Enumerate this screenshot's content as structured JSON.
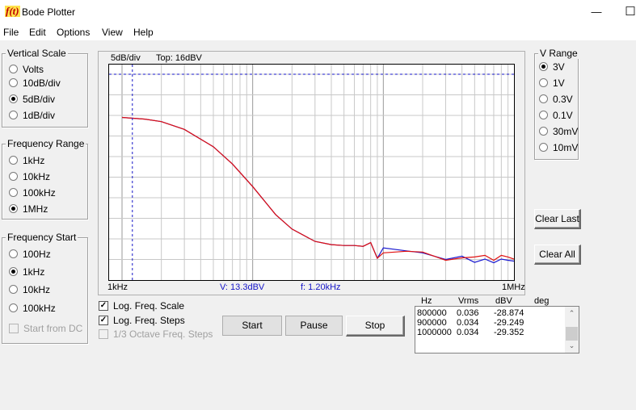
{
  "window": {
    "title": "Bode Plotter",
    "icon_text": "f(t)",
    "minimize_glyph": "—",
    "maximize_glyph": "☐"
  },
  "menu": [
    "File",
    "Edit",
    "Options",
    "View",
    "Help"
  ],
  "vertical_scale": {
    "title": "Vertical Scale",
    "options": [
      "Volts",
      "10dB/div",
      "5dB/div",
      "1dB/div"
    ],
    "selected": 2
  },
  "frequency_range": {
    "title": "Frequency Range",
    "options": [
      "1kHz",
      "10kHz",
      "100kHz",
      "1MHz"
    ],
    "selected": 3
  },
  "frequency_start": {
    "title": "Frequency Start",
    "options": [
      "100Hz",
      "1kHz",
      "10kHz",
      "100kHz"
    ],
    "selected": 1,
    "start_from_dc": "Start from DC"
  },
  "v_range": {
    "title": "V Range",
    "options": [
      "3V",
      "1V",
      "0.3V",
      "0.1V",
      "30mV",
      "10mV"
    ],
    "selected": 0
  },
  "plot": {
    "scale_label": "5dB/div",
    "top_label": "Top:  16dBV",
    "x_start_label": "1kHz",
    "x_end_label": "1MHz",
    "cursor_v": "V: 13.3dBV",
    "cursor_f": "f: 1.20kHz"
  },
  "chart_data": {
    "type": "line",
    "x_scale": "log",
    "xlim_hz": [
      1000,
      1000000
    ],
    "ylim_dbv": [
      -34,
      16
    ],
    "grid": true,
    "cursor": {
      "f_hz": 1200,
      "dbv": 13.3
    },
    "series": [
      {
        "color": "#1a1ad0",
        "x": [
          1000,
          1500,
          2000,
          3000,
          5000,
          7000,
          10000,
          15000,
          20000,
          30000,
          40000,
          50000,
          60000,
          70000,
          80000,
          90000,
          100000,
          150000,
          200000,
          300000,
          400000,
          500000,
          600000,
          700000,
          800000,
          900000,
          1000000
        ],
        "y": [
          5.5,
          5.1,
          4.5,
          2.6,
          -1.6,
          -5.8,
          -11.3,
          -18.1,
          -21.6,
          -24.6,
          -25.4,
          -25.6,
          -25.6,
          -25.8,
          -24.9,
          -28.7,
          -26.2,
          -26.9,
          -27.4,
          -29.0,
          -28.2,
          -29.7,
          -28.9,
          -29.8,
          -28.9,
          -29.2,
          -29.4
        ]
      },
      {
        "color": "#e01010",
        "x": [
          1000,
          1500,
          2000,
          3000,
          5000,
          7000,
          10000,
          15000,
          20000,
          30000,
          40000,
          50000,
          60000,
          70000,
          80000,
          90000,
          100000,
          150000,
          200000,
          300000,
          400000,
          500000,
          600000,
          700000,
          800000,
          900000,
          1000000
        ],
        "y": [
          5.5,
          5.1,
          4.5,
          2.6,
          -1.6,
          -5.8,
          -11.3,
          -18.1,
          -21.6,
          -24.6,
          -25.4,
          -25.6,
          -25.6,
          -25.8,
          -24.9,
          -28.7,
          -27.4,
          -27.0,
          -27.2,
          -29.2,
          -28.6,
          -28.4,
          -28.0,
          -29.2,
          -28.0,
          -28.4,
          -28.9
        ]
      }
    ]
  },
  "options": {
    "log_freq_scale": {
      "label": "Log. Freq. Scale",
      "checked": true
    },
    "log_freq_steps": {
      "label": "Log. Freq. Steps",
      "checked": true
    },
    "octave_steps": {
      "label": "1/3 Octave Freq. Steps",
      "checked": false,
      "disabled": true
    }
  },
  "buttons": {
    "start": "Start",
    "pause": "Pause",
    "stop": "Stop",
    "clear_last": "Clear Last",
    "clear_all": "Clear All"
  },
  "readings": {
    "headers": [
      "Hz",
      "Vrms",
      "dBV",
      "deg"
    ],
    "rows": [
      [
        "800000",
        "0.036",
        "-28.874",
        ""
      ],
      [
        "900000",
        "0.034",
        "-29.249",
        ""
      ],
      [
        "1000000",
        "0.034",
        "-29.352",
        ""
      ]
    ],
    "scroll_up": "⌃",
    "scroll_down": "⌄"
  }
}
